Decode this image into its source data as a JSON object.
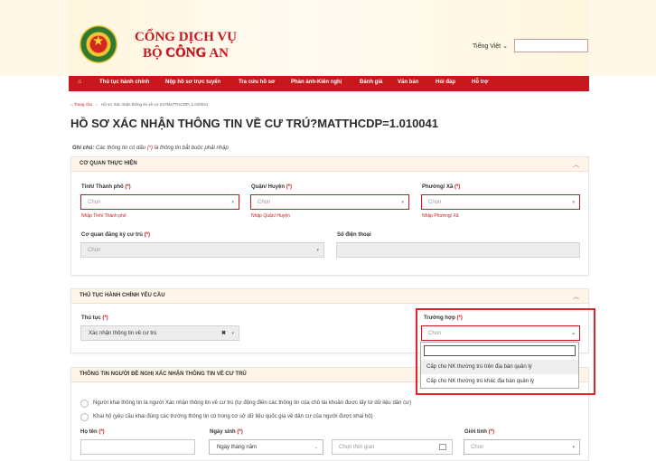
{
  "header": {
    "title_line1": "CỔNG DỊCH VỤ CÔNG",
    "title_line2": "BỘ CÔNG AN",
    "language": "Tiếng Việt ⌄",
    "colors": {
      "brand_red": "#c8181e",
      "header_bg": "#fff8e8"
    }
  },
  "nav": {
    "home_icon": "home-icon",
    "items": [
      "Thủ tục hành chính",
      "Nộp hồ sơ trực tuyến",
      "Tra cứu hồ sơ",
      "Phản ánh-Kiến nghị",
      "Đánh giá",
      "Văn bản",
      "Hỏi đáp",
      "Hỗ trợ"
    ]
  },
  "breadcrumb": {
    "home": "⌂ Trang chủ",
    "sep": "›",
    "current": "Hồ sơ Xác nhận thông tin về cư trú?MaTTHCDP=1.010041"
  },
  "page_title": "HỒ SƠ XÁC NHẬN THÔNG TIN VỀ CƯ TRÚ?MATTHCDP=1.010041",
  "note": {
    "label": "Ghi chú:",
    "text_before": " Các thông tin có dấu ",
    "mark": "(*)",
    "text_after": " là thông tin bắt buộc phải nhập"
  },
  "agency_panel": {
    "title": "CƠ QUAN THỰC HIỆN",
    "province_label": "Tỉnh/ Thành phố",
    "district_label": "Quận/ Huyện",
    "ward_label": "Phường/ Xã",
    "required_mark": "(*)",
    "select_placeholder": "Chọn",
    "province_hint": "Nhập Tỉnh/ Thành phố",
    "district_hint": "Nhập Quận/ Huyện",
    "ward_hint": "Nhập Phường/ Xã",
    "registry_label": "Cơ quan đăng ký cư trú",
    "phone_label": "Số điện thoại"
  },
  "procedure_panel": {
    "title": "THỦ TỤC HÀNH CHÍNH YÊU CẦU",
    "procedure_label": "Thủ tục",
    "procedure_value": "Xác nhận thông tin về cư trú",
    "case_label": "Trường hợp",
    "case_placeholder": "Chọn",
    "case_options": [
      "Cấp cho NK thường trú trên địa bàn quản lý",
      "Cấp cho NK thường trú khác địa bàn quản lý"
    ]
  },
  "applicant_panel": {
    "title": "THÔNG TIN NGƯỜI ĐỀ NGHỊ XÁC NHẬN THÔNG TIN VỀ CƯ TRÚ",
    "radio1": "Người khai thông tin là người Xác nhận thông tin về cư trú (tự động điền các thông tin của chủ tài khoản được lấy từ dữ liệu dân cư)",
    "radio2": "Khai hộ (yêu cầu khai đúng các trường thông tin có trong cơ sở dữ liệu quốc gia về dân cư của người được khai hộ)",
    "name_label": "Họ tên",
    "dob_label": "Ngày sinh",
    "dob_format": "Ngày tháng năm",
    "time_placeholder": "Chọn thời gian",
    "gender_label": "Giới tính",
    "gender_placeholder": "Chọn"
  }
}
